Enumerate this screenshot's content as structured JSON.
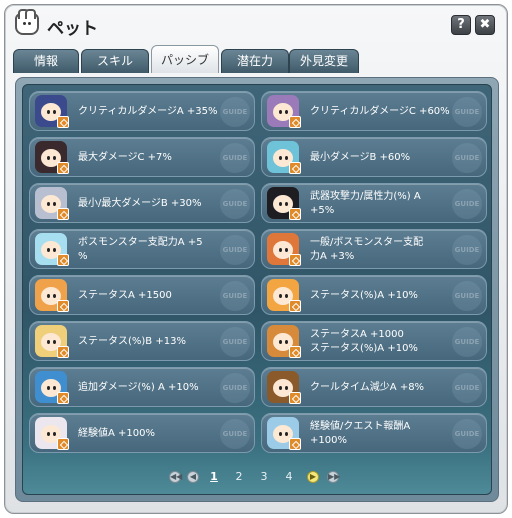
{
  "window": {
    "title": "ペット"
  },
  "title_buttons": {
    "help": "?",
    "close": "✖"
  },
  "tabs": [
    {
      "label": "情報"
    },
    {
      "label": "スキル"
    },
    {
      "label": "パッシブ"
    },
    {
      "label": "潜在力"
    },
    {
      "label": "外見変更"
    }
  ],
  "cards": [
    {
      "line1": "クリティカルダメージA +35%",
      "line2": "",
      "guide": "GUIDE",
      "icon": "blue-white-fairy-pet",
      "color": "#3b4a8c"
    },
    {
      "line1": "クリティカルダメージC +60%",
      "line2": "",
      "guide": "GUIDE",
      "icon": "pink-hat-girl-pet",
      "color": "#9a7ab8"
    },
    {
      "line1": "最大ダメージC +7%",
      "line2": "",
      "guide": "GUIDE",
      "icon": "black-red-girl-pet",
      "color": "#3a2a2e"
    },
    {
      "line1": "最小ダメージB +60%",
      "line2": "",
      "guide": "GUIDE",
      "icon": "cyan-hair-girl-pet",
      "color": "#6fc3d8"
    },
    {
      "line1": "最小/最大ダメージB +30%",
      "line2": "",
      "guide": "GUIDE",
      "icon": "silver-girl-pet",
      "color": "#b7bfd0"
    },
    {
      "line1": "武器攻撃力/属性力(%) A",
      "line2": "+5%",
      "guide": "GUIDE",
      "icon": "penguin-pet",
      "color": "#1e1e22"
    },
    {
      "line1": "ボスモンスター支配力A +5",
      "line2": "%",
      "guide": "GUIDE",
      "icon": "ice-golem-pet",
      "color": "#a8dff0"
    },
    {
      "line1": "一般/ボスモンスター支配",
      "line2": "力A +3%",
      "guide": "GUIDE",
      "icon": "orange-bear-pet",
      "color": "#e0773a"
    },
    {
      "line1": "ステータスA +1500",
      "line2": "",
      "guide": "GUIDE",
      "icon": "orange-fox-pet",
      "color": "#f0a24a"
    },
    {
      "line1": "ステータス(%)A +10%",
      "line2": "",
      "guide": "GUIDE",
      "icon": "orange-cat-pet",
      "color": "#f2a540"
    },
    {
      "line1": "ステータス(%)B +13%",
      "line2": "",
      "guide": "GUIDE",
      "icon": "blonde-girl-pet",
      "color": "#f0cf7a"
    },
    {
      "line1": "ステータスA +1000",
      "line2": "ステータス(%)A +10%",
      "guide": "GUIDE",
      "icon": "lion-pet",
      "color": "#d68a3a"
    },
    {
      "line1": "追加ダメージ(%) A +10%",
      "line2": "",
      "guide": "GUIDE",
      "icon": "blue-dragon-pet",
      "color": "#3f8fd0"
    },
    {
      "line1": "クールタイム減少A +8%",
      "line2": "",
      "guide": "GUIDE",
      "icon": "bronze-robot-pet",
      "color": "#8a5a2a"
    },
    {
      "line1": "経験値A +100%",
      "line2": "",
      "guide": "GUIDE",
      "icon": "white-bunny-pet",
      "color": "#ece6ef"
    },
    {
      "line1": "経験値/クエスト報酬A",
      "line2": "+100%",
      "guide": "GUIDE",
      "icon": "top-hat-cat-pet",
      "color": "#9ccbe8"
    }
  ],
  "pagination": {
    "first": "◀◀",
    "prev": "◀",
    "pages": [
      "1",
      "2",
      "3",
      "4"
    ],
    "current": "1",
    "next": "▶",
    "last": "▶▶"
  }
}
